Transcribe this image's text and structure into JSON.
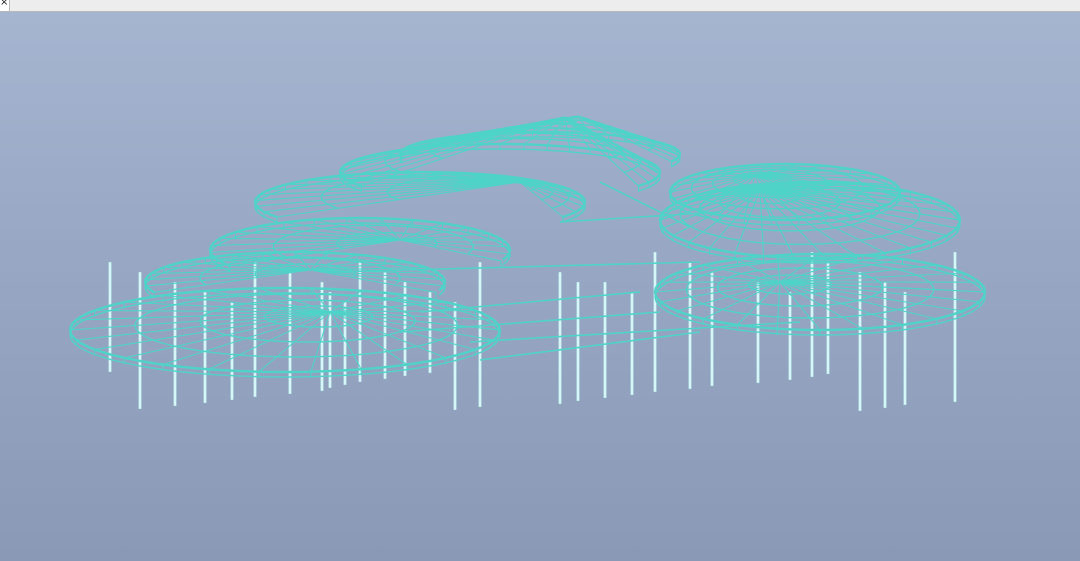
{
  "window": {
    "close_label": "×"
  },
  "viewport": {
    "background_top": "#a6b5d0",
    "background_bottom": "#8a9ab6",
    "structure_color": "#4fd3c9",
    "column_color": "#d6f6f8"
  }
}
